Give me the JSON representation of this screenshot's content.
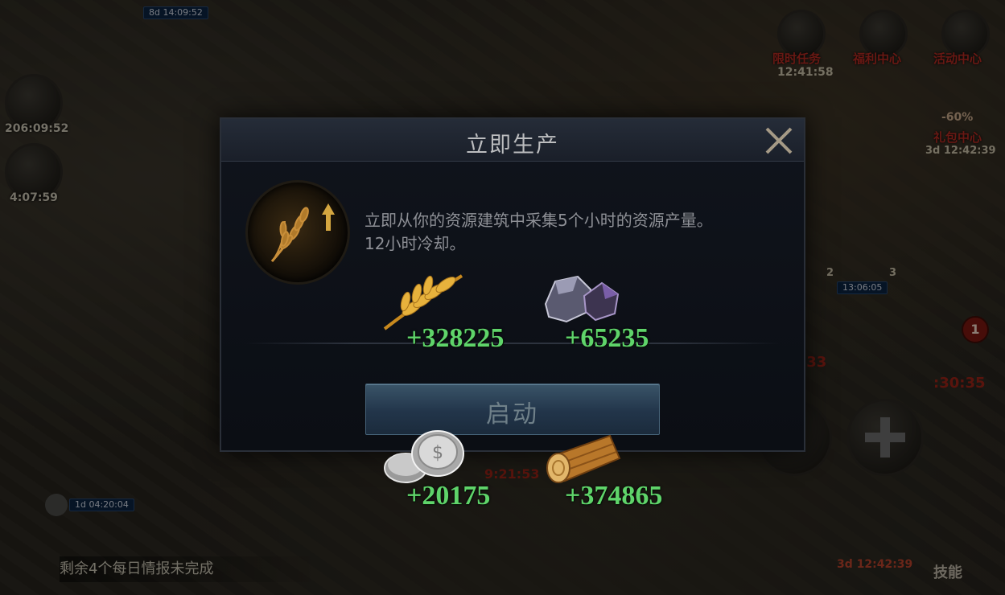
{
  "background": {
    "timers": [
      "206:09:52",
      "4:07:59",
      "9:21:53",
      "12:41:58",
      "3d 12:42:39"
    ],
    "pills": [
      "8d 14:09:52",
      "1d 04:20:04",
      "13:06:05"
    ],
    "menu": {
      "limited_task": "限时任务",
      "welfare_center": "福利中心",
      "activity_center": "活动中心",
      "gift_center": "礼包中心",
      "gift_discount": "-60%",
      "gift_timer": "3d 12:42:39"
    },
    "red_timer_1": ":33",
    "red_timer_2": ":30:35",
    "badge_count": "1",
    "scroll_counts": [
      "2",
      "3"
    ],
    "daily_report": "剩余4个每日情报未完成",
    "skills_label": "技能",
    "bottom_timer": "3d 12:42:39"
  },
  "dialog": {
    "title": "立即生产",
    "description_line1": "立即从你的资源建筑中采集5个小时的资源产量。",
    "description_line2": "12小时冷却。",
    "start_label": "启动"
  },
  "resources": [
    {
      "name": "food",
      "icon": "wheat-icon",
      "amount": "+328225"
    },
    {
      "name": "ore",
      "icon": "ore-icon",
      "amount": "+65235"
    },
    {
      "name": "silver",
      "icon": "silver-coins-icon",
      "amount": "+20175"
    },
    {
      "name": "wood",
      "icon": "wood-log-icon",
      "amount": "+374865"
    }
  ],
  "colors": {
    "amount_green": "#5fd46a",
    "title_text": "#bcbdbf",
    "button_blue": "#2b4358"
  }
}
